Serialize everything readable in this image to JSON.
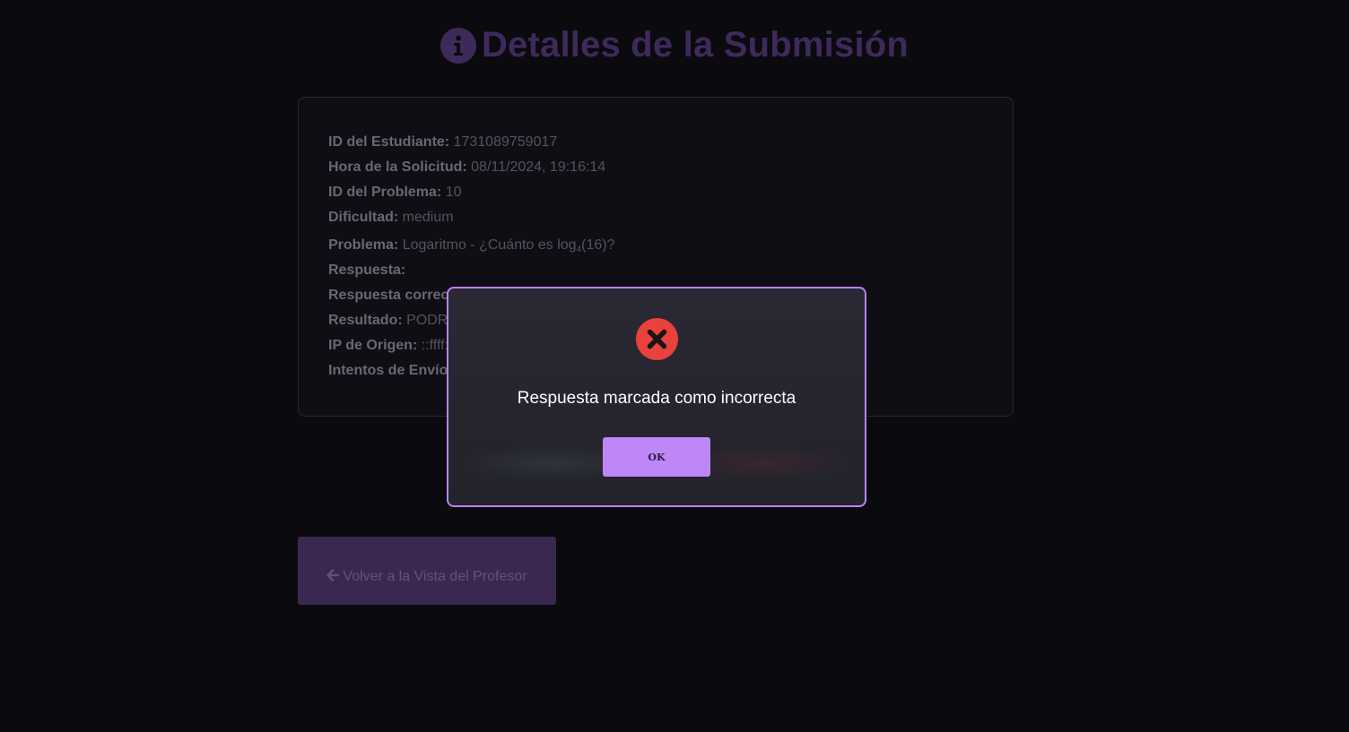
{
  "header": {
    "icon": "info-circle-icon",
    "title": "Detalles de la Submisión"
  },
  "details": {
    "student_id_label": "ID del Estudiante:",
    "student_id_value": "1731089759017",
    "request_time_label": "Hora de la Solicitud:",
    "request_time_value": "08/11/2024, 19:16:14",
    "problem_id_label": "ID del Problema:",
    "problem_id_value": "10",
    "difficulty_label": "Dificultad:",
    "difficulty_value": "medium",
    "problem_label": "Problema:",
    "problem_value_prefix": "Logaritmo - ¿Cuánto es log",
    "problem_value_subscript": "4",
    "problem_value_suffix": "(16)?",
    "answer_label": "Respuesta:",
    "answer_value": "",
    "correct_answer_label": "Respuesta correc",
    "result_label": "Resultado:",
    "result_value": "PODR",
    "origin_ip_label": "IP de Origen:",
    "origin_ip_value": "::ffff:",
    "attempts_label": "Intentos de Envío"
  },
  "back_button": {
    "icon": "arrow-left-icon",
    "label": "Volver a la Vista del Profesor"
  },
  "modal": {
    "icon": "error-x-icon",
    "message": "Respuesta marcada como incorrecta",
    "ok_label": "OK"
  },
  "colors": {
    "background": "#0b0a0f",
    "title": "#3d2a5a",
    "modal_border": "#b884f0",
    "ok_button": "#bf86f8",
    "error_icon": "#e9413c",
    "back_button": "#3b2850"
  }
}
